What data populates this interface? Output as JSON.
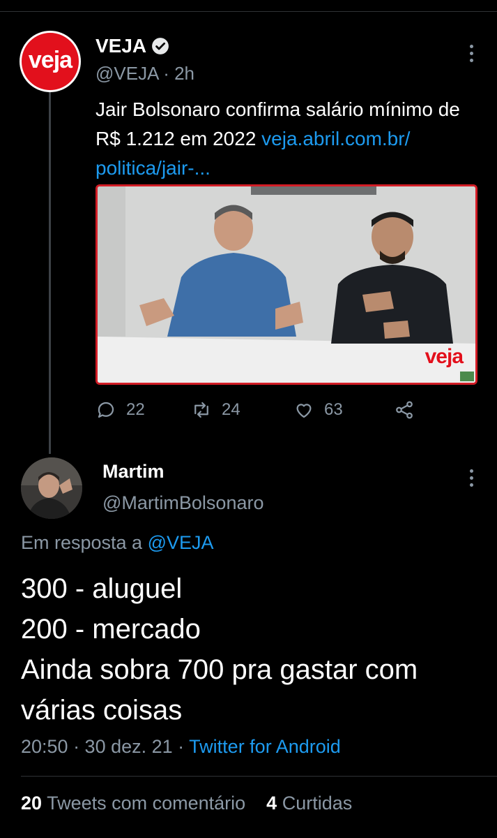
{
  "parent": {
    "avatar_text": "veja",
    "name": "VEJA",
    "handle_time": "@VEJA · 2h",
    "text_part1": "Jair Bolsonaro confirma salário mínimo de R$ 1.212 em 2022 ",
    "link": "veja.abril.com.br/ politica/jair-...",
    "media_logo": "veja",
    "replies": "22",
    "retweets": "24",
    "likes": "63"
  },
  "reply": {
    "name": "Martim",
    "handle": "@MartimBolsonaro",
    "reply_to_prefix": "Em resposta a ",
    "reply_to_handle": "@VEJA",
    "lines": [
      "300 - aluguel",
      "200 - mercado",
      "Ainda sobra 700 pra gastar com",
      "várias coisas"
    ],
    "time_date": "20:50 · 30 dez. 21 · ",
    "source": "Twitter for Android"
  },
  "stats": {
    "quote_count": "20",
    "quote_label": "Tweets com comentário",
    "like_count": "4",
    "like_label": "Curtidas"
  },
  "colors": {
    "background": "#000000",
    "link": "#1d9bf0",
    "muted": "#8b98a5",
    "veja_red": "#e2101c"
  }
}
